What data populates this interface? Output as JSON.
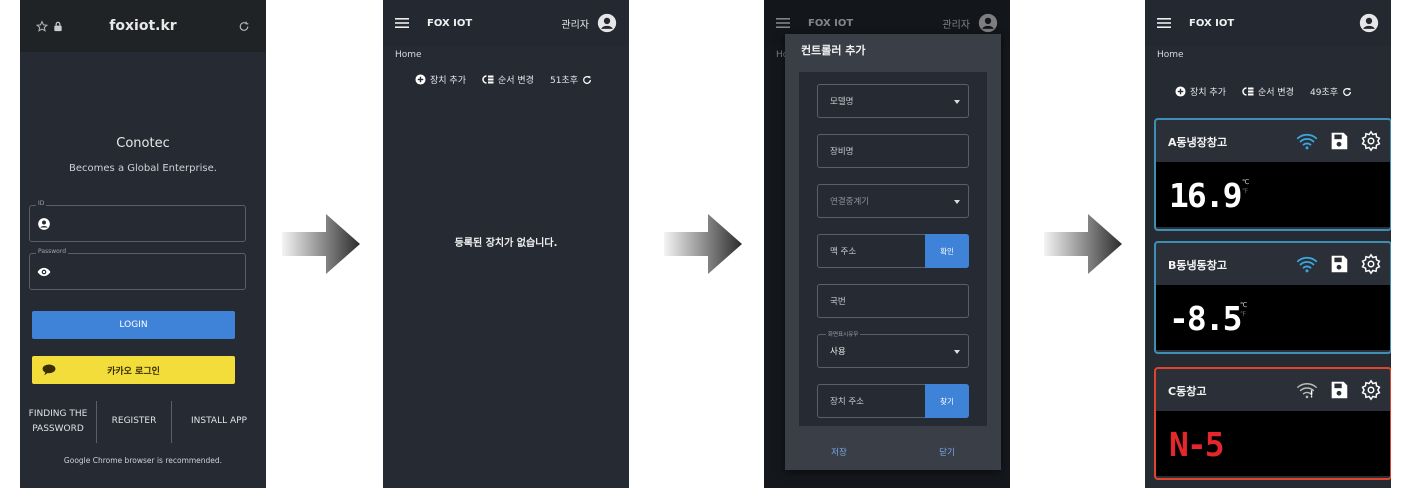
{
  "login_screen": {
    "url": "foxiot.kr",
    "brand": "Conotec",
    "tagline": "Becomes a Global Enterprise.",
    "id_label": "ID",
    "password_label": "Password",
    "login_button": "LOGIN",
    "kakao_button": "카카오 로그인",
    "links": [
      "FINDING THE PASSWORD",
      "REGISTER",
      "INSTALL APP"
    ],
    "note": "Google Chrome browser is recommended."
  },
  "app": {
    "title": "FOX IOT",
    "user": "관리자",
    "breadcrumb": "Home",
    "add_device": "장치 추가",
    "reorder": "순서 변경"
  },
  "empty_screen": {
    "refresh_timer": "51초후",
    "empty_message": "등록된 장치가 없습니다."
  },
  "add_dialog": {
    "title": "컨트롤러 추가",
    "model_placeholder": "모델명",
    "device_name_placeholder": "장비명",
    "relay_placeholder": "연결중계기",
    "mac_placeholder": "맥 주소",
    "confirm_button": "확인",
    "channel_placeholder": "국번",
    "screen_display_label": "화면표시유무",
    "screen_display_value": "사용",
    "device_address_placeholder": "장치 주소",
    "find_button": "찾기",
    "save_button": "저장",
    "close_button": "닫기"
  },
  "devices_screen": {
    "refresh_timer": "49초후",
    "devices": [
      {
        "name": "A동냉장창고",
        "temperature": "16.9",
        "unit_c": "℃",
        "unit_f": "℉",
        "wifi": "connected",
        "status": "normal"
      },
      {
        "name": "B동냉동창고",
        "temperature": "-8.5",
        "unit_c": "℃",
        "unit_f": "℉",
        "wifi": "connected",
        "status": "normal"
      },
      {
        "name": "C동창고",
        "temperature": "N-5",
        "wifi": "disconnected",
        "status": "alert"
      }
    ]
  },
  "colors": {
    "background": "#252a33",
    "login_button": "#3f83d8",
    "kakao_button": "#f2dd3b",
    "normal_border": "#3e8fb4",
    "alert_border": "#e0452b",
    "alert_text": "#e5262b"
  },
  "icons": [
    "star-icon",
    "lock-icon",
    "reload-icon",
    "user-icon",
    "eye-icon",
    "chat-bubble-icon",
    "menu-icon",
    "account-icon",
    "plus-circle-icon",
    "reorder-icon",
    "refresh-icon",
    "wifi-icon",
    "wifi-off-icon",
    "save-icon",
    "settings-icon",
    "arrow-icon"
  ]
}
